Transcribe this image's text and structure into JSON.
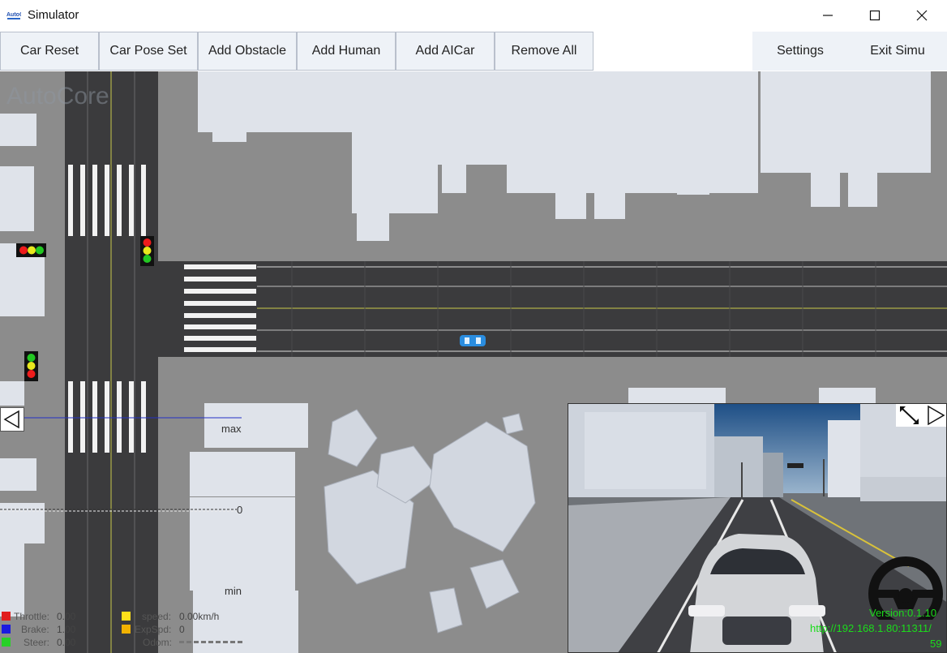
{
  "window": {
    "title": "Simulator",
    "controls": {
      "minimize": "minimize-icon",
      "maximize": "maximize-icon",
      "close": "close-icon"
    }
  },
  "toolbar": {
    "buttons": [
      "Car Reset",
      "Car Pose Set",
      "Add Obstacle",
      "Add Human",
      "Add AICar",
      "Remove All"
    ],
    "right": [
      "Settings",
      "Exit Simu"
    ]
  },
  "map": {
    "watermark": "AutoCore",
    "gauge": {
      "max_label": "max",
      "zero_label": "0",
      "min_label": "min"
    },
    "left_arrow_icon": "triangle-left-icon"
  },
  "telemetry": {
    "throttle_label": "Throttle:",
    "throttle_value": "0.00",
    "brake_label": "Brake:",
    "brake_value": "1.00",
    "steer_label": "Steer:",
    "steer_value": "0.00",
    "speed_label": "speed:",
    "speed_value": "0.00km/h",
    "expspd_label": "ExpSpd:",
    "expspd_value": "0",
    "odom_label": "Odom:",
    "colors": {
      "throttle": "#e11d1d",
      "brake": "#1a1ae0",
      "steer": "#27d127",
      "speed": "#ffe01a",
      "expspd": "#f2b200"
    }
  },
  "camera": {
    "version": "Version:0.1.10",
    "url": "http://192.168.1.80:11311/",
    "fps": "59",
    "expand_icon": "expand-icon",
    "right_arrow_icon": "triangle-right-icon",
    "wheel_icon": "steering-wheel-icon"
  }
}
